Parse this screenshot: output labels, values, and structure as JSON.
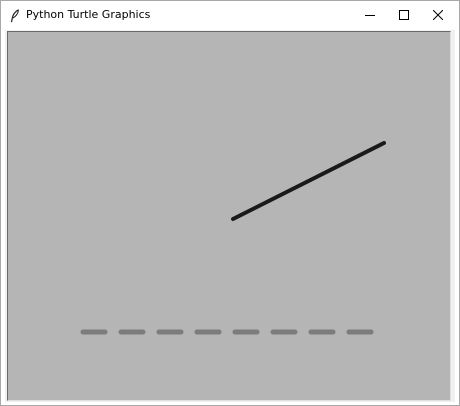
{
  "window": {
    "title": "Python Turtle Graphics",
    "app_icon": "feather-icon",
    "controls": {
      "minimize": "minimize-icon",
      "maximize": "maximize-icon",
      "close": "close-icon"
    }
  },
  "canvas": {
    "background_color": "#b5b5b5",
    "line_color": "#1a1a1a",
    "dash_color": "#7c7c7c",
    "dash_count": 8
  }
}
